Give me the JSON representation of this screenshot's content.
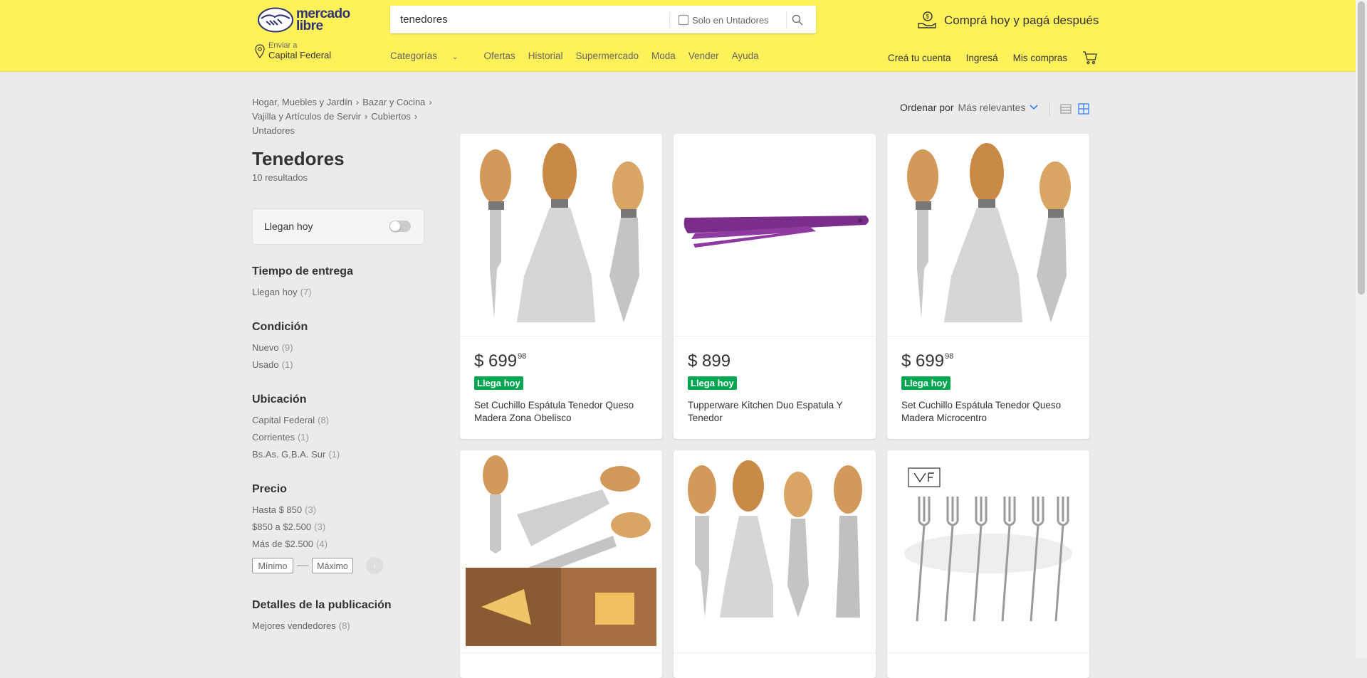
{
  "header": {
    "logo_line1": "mercado",
    "logo_line2": "libre",
    "search_value": "tenedores",
    "search_checkbox_label": "Solo en Untadores",
    "promo": "Comprá hoy y pagá después",
    "location_label": "Enviar a",
    "location_value": "Capital Federal",
    "nav": [
      "Categorías",
      "Ofertas",
      "Historial",
      "Supermercado",
      "Moda",
      "Vender",
      "Ayuda"
    ],
    "user_nav": [
      "Creá tu cuenta",
      "Ingresá",
      "Mis compras"
    ]
  },
  "breadcrumb": [
    "Hogar, Muebles y Jardín",
    "Bazar y Cocina",
    "Vajilla y Artículos de Servir",
    "Cubiertos",
    "Untadores"
  ],
  "page_title": "Tenedores",
  "result_count": "10 resultados",
  "toggle_label": "Llegan hoy",
  "filters": {
    "delivery": {
      "title": "Tiempo de entrega",
      "items": [
        {
          "label": "Llegan hoy",
          "count": "(7)"
        }
      ]
    },
    "condition": {
      "title": "Condición",
      "items": [
        {
          "label": "Nuevo",
          "count": "(9)"
        },
        {
          "label": "Usado",
          "count": "(1)"
        }
      ]
    },
    "location": {
      "title": "Ubicación",
      "items": [
        {
          "label": "Capital Federal",
          "count": "(8)"
        },
        {
          "label": "Corrientes",
          "count": "(1)"
        },
        {
          "label": "Bs.As. G.B.A. Sur",
          "count": "(1)"
        }
      ]
    },
    "price": {
      "title": "Precio",
      "items": [
        {
          "label": "Hasta $ 850",
          "count": "(3)"
        },
        {
          "label": "$850 a $2.500",
          "count": "(3)"
        },
        {
          "label": "Más de $2.500",
          "count": "(4)"
        }
      ],
      "min_placeholder": "Mínimo",
      "max_placeholder": "Máximo"
    },
    "details": {
      "title": "Detalles de la publicación",
      "items": [
        {
          "label": "Mejores vendedores",
          "count": "(8)"
        }
      ]
    }
  },
  "sort": {
    "label": "Ordenar por",
    "value": "Más relevantes"
  },
  "products": [
    {
      "price": "$ 699",
      "cents": "98",
      "badge": "Llega hoy",
      "title": "Set Cuchillo Espátula Tenedor Queso Madera Zona Obelisco"
    },
    {
      "price": "$ 899",
      "cents": "",
      "badge": "Llega hoy",
      "title": "Tupperware Kitchen Duo Espatula Y Tenedor"
    },
    {
      "price": "$ 699",
      "cents": "98",
      "badge": "Llega hoy",
      "title": "Set Cuchillo Espátula Tenedor Queso Madera Microcentro"
    }
  ],
  "colors": {
    "header_bg": "#fff159",
    "badge_green": "#00a650",
    "accent_blue": "#3483fa"
  }
}
